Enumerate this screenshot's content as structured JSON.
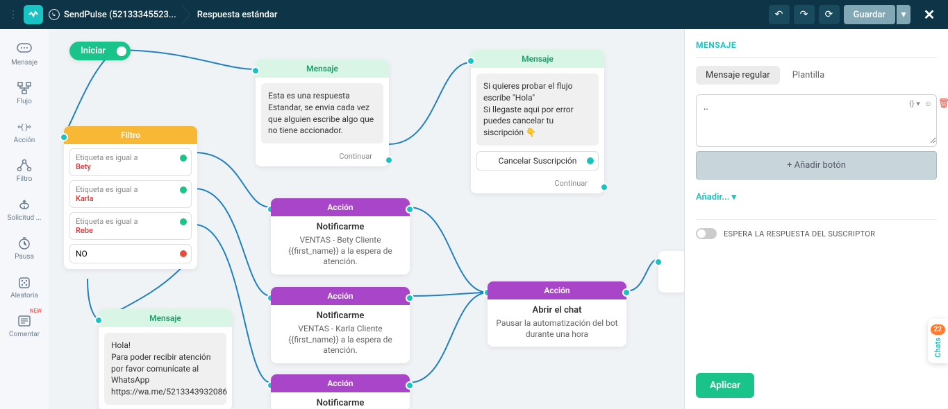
{
  "header": {
    "app_name": "SendPulse (52133345523...",
    "page_title": "Respuesta estándar",
    "save_label": "Guardar"
  },
  "toolbar": {
    "items": [
      {
        "label": "Mensaje",
        "icon": "message"
      },
      {
        "label": "Flujo",
        "icon": "flow"
      },
      {
        "label": "Acción",
        "icon": "action"
      },
      {
        "label": "Filtro",
        "icon": "filter"
      },
      {
        "label": "Solicitud ...",
        "icon": "api"
      },
      {
        "label": "Pausa",
        "icon": "pause"
      },
      {
        "label": "Aleatoria",
        "icon": "random"
      },
      {
        "label": "Comentar",
        "icon": "comment"
      }
    ],
    "new_badge": "NEW"
  },
  "nodes": {
    "start": "Iniciar",
    "msg1": {
      "title": "Mensaje",
      "body": "Esta es una respuesta Estandar, se envia cada vez que alguien escribe algo que no tiene accionador.",
      "continue": "Continuar"
    },
    "msg2": {
      "title": "Mensaje",
      "body": "Si quieres probar el flujo escribe \"Hola\"\nSi llegaste aqui por error puedes cancelar tu siscripción 👇",
      "button": "Cancelar Suscripción",
      "continue": "Continuar"
    },
    "filter": {
      "title": "Filtro",
      "cond_label": "Etiqueta",
      "cond_op": "es igual a",
      "conds": [
        "Bety",
        "Karla",
        "Rebe"
      ],
      "no_label": "NO"
    },
    "msg3": {
      "title": "Mensaje",
      "body": "Hola!\nPara poder recibir atención por favor comunícate al WhatsApp https://wa.me/5213343932086"
    },
    "action1": {
      "title": "Acción",
      "subtitle": "Notificarme",
      "body": "VENTAS - Bety Cliente {{first_name}} a la espera de atención."
    },
    "action2": {
      "title": "Acción",
      "subtitle": "Notificarme",
      "body": "VENTAS - Karla Cliente {{first_name}} a la espera de atención."
    },
    "action3": {
      "title": "Acción",
      "subtitle": "Notificarme"
    },
    "action4": {
      "title": "Acción",
      "subtitle": "Abrir el chat",
      "body": "Pausar la automatización del bot durante  una hora"
    }
  },
  "panel": {
    "title": "MENSAJE",
    "tabs": [
      "Mensaje regular",
      "Plantilla"
    ],
    "editor_value": "..",
    "var_badge": "{} ▾",
    "add_button": "+ Añadir botón",
    "add_link": "Añadir... ▾",
    "toggle_label": "ESPERA LA RESPUESTA DEL SUSCRIPTOR",
    "apply": "Aplicar"
  },
  "chats": {
    "count": "22",
    "label": "Chats"
  }
}
